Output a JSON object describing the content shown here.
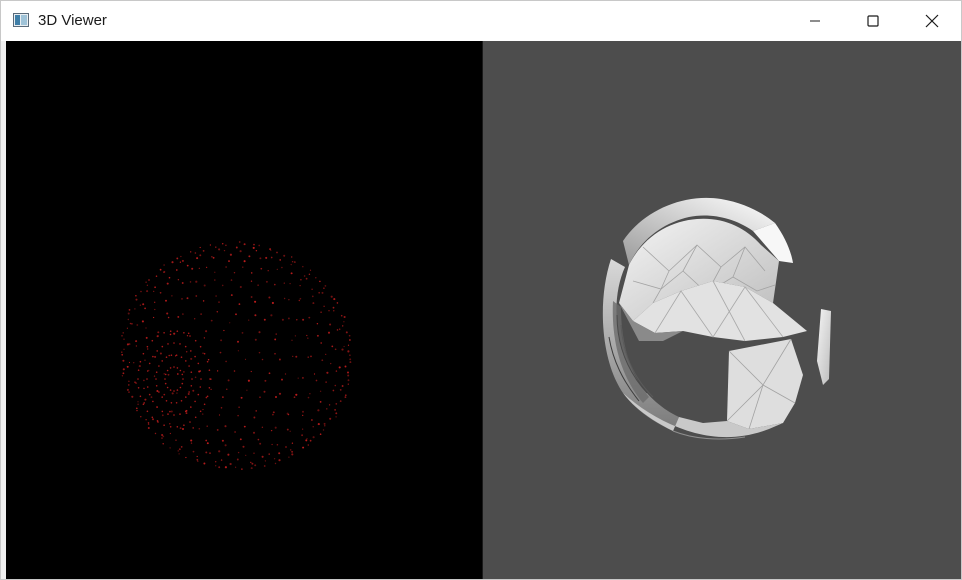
{
  "window": {
    "title": "3D Viewer",
    "app_icon": "window-app-icon",
    "controls": {
      "minimize_icon": "minimize-icon",
      "maximize_icon": "maximize-icon",
      "close_icon": "close-icon"
    }
  },
  "viewports": {
    "point_cloud": {
      "background": "#000000",
      "point_color": "#c81e1e",
      "icon": "point-cloud-view"
    },
    "mesh": {
      "background": "#4d4d4d",
      "mesh_color": "#e6e6e6",
      "icon": "mesh-view"
    }
  }
}
